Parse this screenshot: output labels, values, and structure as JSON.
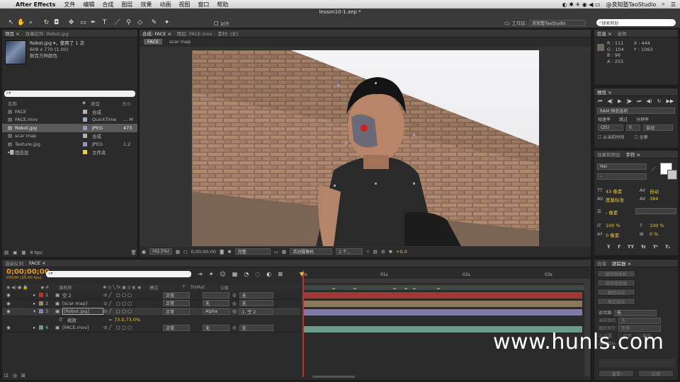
{
  "menubar": {
    "app": "After Effects",
    "items": [
      "文件",
      "编辑",
      "合成",
      "图层",
      "效果",
      "动画",
      "视图",
      "窗口",
      "帮助"
    ],
    "user": "@良知塾TaoStudio"
  },
  "toolbar": {
    "align_label": "对齐",
    "workspace_label": "工作区:",
    "workspace_value": "良知塾TaoStudio",
    "search_placeholder": "搜索帮助"
  },
  "document_title": "lesson10-1.aep *",
  "project_panel": {
    "tabs": [
      "项目 ×",
      "效果控件: Robot.jpg"
    ],
    "selected_name": "Robot.jpg ▾，使用了 1 次",
    "selected_dims": "608 x 770 (1.00)",
    "selected_color": "数百万种颜色",
    "col_name": "名称",
    "col_type": "类型",
    "col_size": "大小",
    "items": [
      {
        "name": "FACE",
        "type": "合成",
        "size": "",
        "color": "#b0b0b0"
      },
      {
        "name": "FACE.mov",
        "type": "QuickTime",
        "size": "... M",
        "color": "#a0a8c0"
      },
      {
        "name": "Robot.jpg",
        "type": "JPEG",
        "size": "473",
        "color": "#a090c0"
      },
      {
        "name": "scar map",
        "type": "合成",
        "size": "",
        "color": "#b0b0b0"
      },
      {
        "name": "Texture.jpg",
        "type": "JPEG",
        "size": "1.2",
        "color": "#a090c0"
      },
      {
        "name": "固态层",
        "type": "文件夹",
        "size": "",
        "color": "#e8d040"
      }
    ],
    "bpc": "8 bpc"
  },
  "comp_panel": {
    "tabs": [
      "合成: FACE ×",
      "图层: FACE.mov",
      "素材: (无)"
    ],
    "subtabs": [
      "FACE",
      "scar map"
    ],
    "zoom": "(42.5%)",
    "timecode": "0;00;00;00",
    "resolution": "完整",
    "camera": "活动摄像机",
    "views": "1 个...",
    "exposure": "+0.0"
  },
  "info_panel": {
    "tabs": [
      "信息 ×",
      "音频"
    ],
    "r": "R : 111",
    "g": "G : 104",
    "b": "B : 96",
    "a": "A : 255",
    "x": "X : 444",
    "y": "Y : 1063"
  },
  "preview_panel": {
    "tab": "预览 ×",
    "ram_label": "RAM 预览选项",
    "frame_rate_label": "帧速率",
    "skip_label": "跳过",
    "resolution_label": "分辨率",
    "frame_rate": "(25)",
    "skip": "0",
    "resolution": "自动",
    "from_current": "从当前时间",
    "full_screen": "全屏"
  },
  "character_panel": {
    "tabs": [
      "效果和预设",
      "字符 ×"
    ],
    "font": "Hei",
    "style": "-",
    "size": "43 像素",
    "leading": "自动",
    "kerning": "度量标准",
    "tracking": "384",
    "stroke": "- 像素",
    "v_scale": "100 %",
    "h_scale": "100 %",
    "baseline": "0 像素",
    "tsume": "0 %",
    "styles": [
      "T",
      "T",
      "TT",
      "Tr",
      "T¹",
      "T₁"
    ]
  },
  "tracker_panel": {
    "tabs": [
      "段落",
      "跟踪器 ×"
    ],
    "btn_track_camera": "跟踪摄像机",
    "btn_warp": "变形稳定器",
    "btn_track_motion": "跟踪运动",
    "btn_stabilize": "稳定运动",
    "motion_source_label": "运动源:",
    "motion_source": "无",
    "current_track_label": "当前跟踪:",
    "current_track": "无",
    "track_type_label": "跟踪类型:",
    "track_type": "变换",
    "position": "位置",
    "rotation": "旋转",
    "scale": "缩放",
    "motion_target": "运动目标:",
    "reset": "重置",
    "apply": "应用"
  },
  "timeline": {
    "tabs": [
      "渲染队列",
      "FACE ×"
    ],
    "timecode": "0;00;00;00",
    "fps": "00000 (25.00 fps)",
    "col_source": "源名称",
    "col_mode": "模式",
    "col_t": "T",
    "col_trkmat": "TrkMat",
    "col_parent": "父级",
    "ruler": [
      "0s",
      "01s",
      "02s",
      "03s"
    ],
    "layers": [
      {
        "num": "1",
        "name": "空 2",
        "mode": "正常",
        "trkmat": "",
        "parent": "无",
        "label": "#c03030",
        "bar": "#9a3a3a"
      },
      {
        "num": "2",
        "name": "[scar map]",
        "mode": "正常",
        "trkmat": "无",
        "parent": "无",
        "label": "#a08a5a",
        "bar": "#8a7a5a"
      },
      {
        "num": "3",
        "name": "[Robot.jpg]",
        "mode": "正常",
        "trkmat": "Alpha",
        "parent": "1. 空 2",
        "label": "#8a80b8",
        "bar": "#7f7aa8"
      },
      {
        "num": "4",
        "name": "[FACE.mov]",
        "mode": "正常",
        "trkmat": "无",
        "parent": "无",
        "label": "#6a9a8a",
        "bar": "#6a9a88"
      }
    ],
    "scale_label": "缩放",
    "scale_value": "73.0,73.0%"
  },
  "watermark": "www.hunls.com",
  "colors": {
    "accent": "#e8c440",
    "timecode": "#e89a28",
    "playhead": "#c03030"
  }
}
